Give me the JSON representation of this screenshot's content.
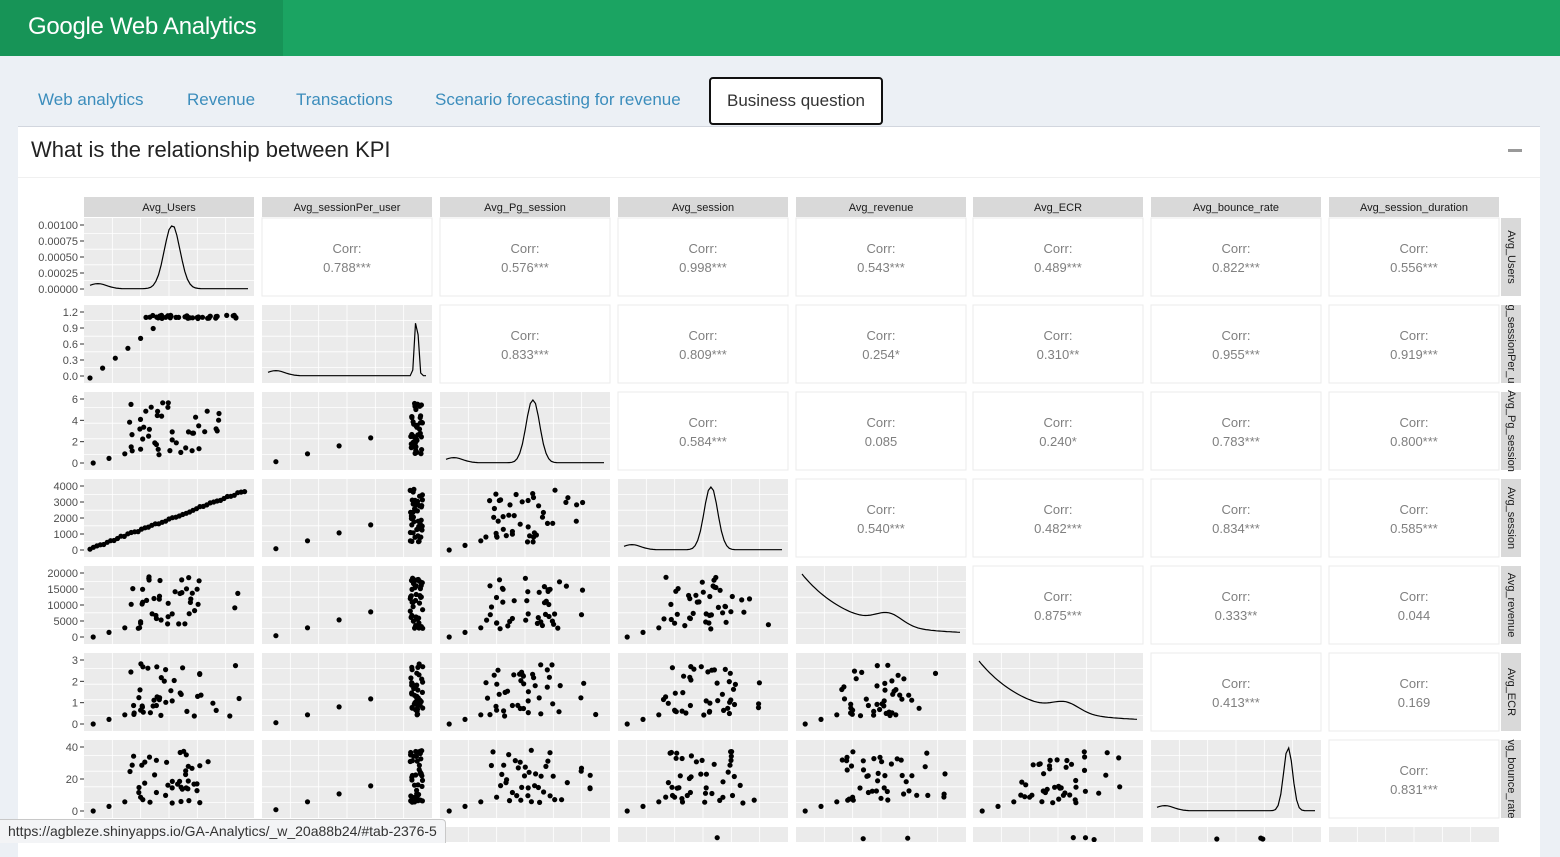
{
  "app": {
    "title": "Google Web Analytics"
  },
  "tabs": [
    {
      "label": "Web analytics"
    },
    {
      "label": "Revenue"
    },
    {
      "label": "Transactions"
    },
    {
      "label": "Scenario forecasting for revenue"
    },
    {
      "label": "Business question"
    }
  ],
  "panel": {
    "title": "What is the relationship between KPI"
  },
  "status_url": "https://agbleze.shinyapps.io/GA-Analytics/_w_20a88b24/#tab-2376-5",
  "chart_data": {
    "type": "scatter",
    "variables": [
      "Avg_Users",
      "Avg_sessionPer_user",
      "Avg_Pg_session",
      "Avg_session",
      "Avg_revenue",
      "Avg_ECR",
      "Avg_bounce_rate",
      "Avg_session_duration"
    ],
    "correlations": [
      [
        null,
        "0.788***",
        "0.576***",
        "0.998***",
        "0.543***",
        "0.489***",
        "0.822***",
        "0.556***"
      ],
      [
        null,
        null,
        "0.833***",
        "0.809***",
        "0.254*",
        "0.310**",
        "0.955***",
        "0.919***"
      ],
      [
        null,
        null,
        null,
        "0.584***",
        "0.085",
        "0.240*",
        "0.783***",
        "0.800***"
      ],
      [
        null,
        null,
        null,
        null,
        "0.540***",
        "0.482***",
        "0.834***",
        "0.585***"
      ],
      [
        null,
        null,
        null,
        null,
        null,
        "0.875***",
        "0.333**",
        "0.044"
      ],
      [
        null,
        null,
        null,
        null,
        null,
        null,
        "0.413***",
        "0.169"
      ],
      [
        null,
        null,
        null,
        null,
        null,
        null,
        null,
        "0.831***"
      ]
    ],
    "corr_prefix": "Corr:",
    "strip_labels_right": [
      "Avg_Users",
      "g_sessionPer_u",
      "Avg_Pg_session",
      "Avg_session",
      "Avg_revenue",
      "Avg_ECR",
      "vg_bounce_rate"
    ],
    "row_axes": [
      {
        "ticks": [
          "0.00100",
          "0.00075",
          "0.00050",
          "0.00025",
          "0.00000"
        ]
      },
      {
        "ticks": [
          "1.2",
          "0.9",
          "0.6",
          "0.3",
          "0.0"
        ]
      },
      {
        "ticks": [
          "6",
          "4",
          "2",
          "0"
        ]
      },
      {
        "ticks": [
          "4000",
          "3000",
          "2000",
          "1000",
          "0"
        ]
      },
      {
        "ticks": [
          "20000",
          "15000",
          "10000",
          "5000",
          "0"
        ]
      },
      {
        "ticks": [
          "3",
          "2",
          "1",
          "0"
        ]
      },
      {
        "ticks": [
          "40",
          "20",
          "0"
        ]
      }
    ],
    "grid": true
  }
}
